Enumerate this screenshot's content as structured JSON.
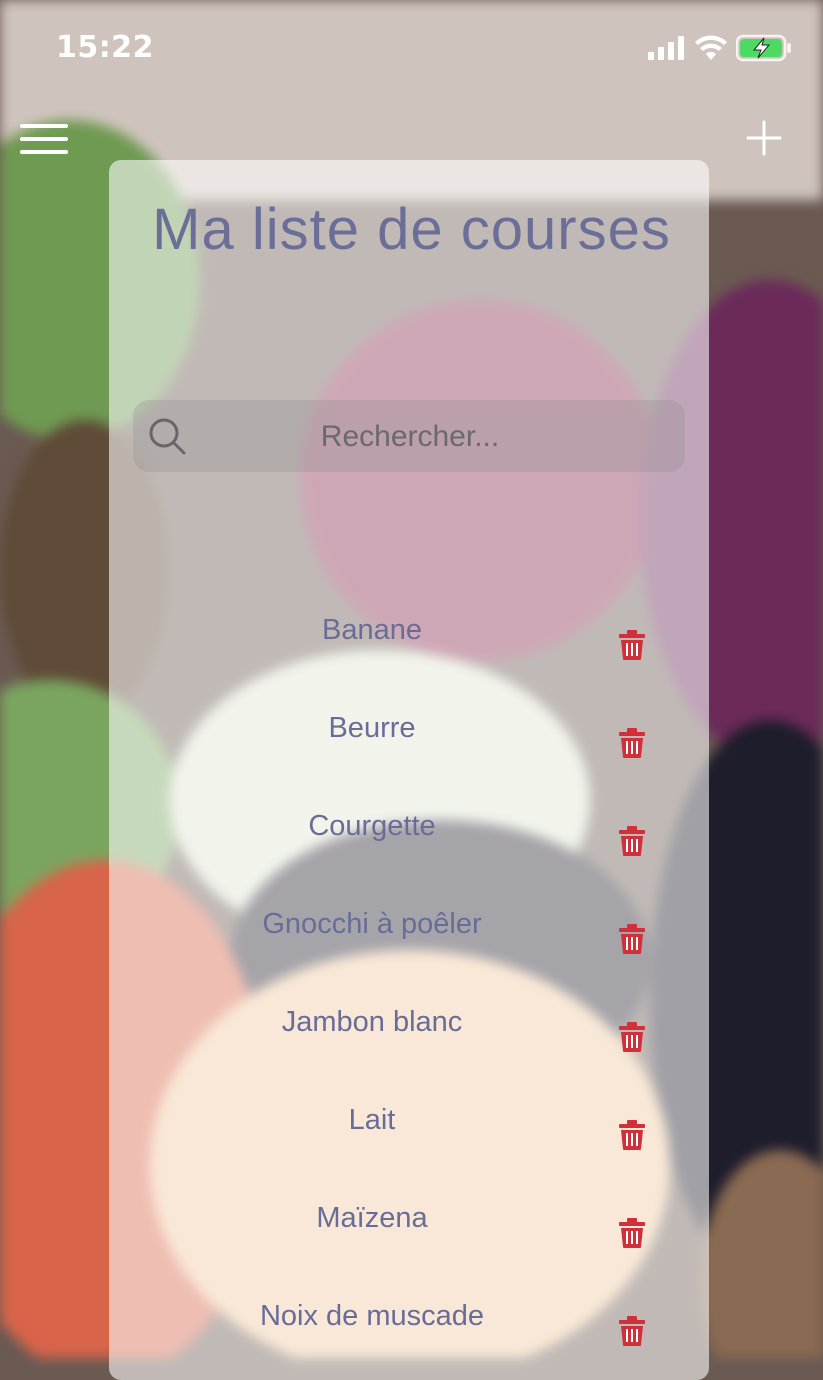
{
  "status_bar": {
    "time": "15:22",
    "icons": [
      "cellular-signal-icon",
      "wifi-icon",
      "battery-charging-icon"
    ]
  },
  "nav": {
    "menu_icon": "hamburger-menu-icon",
    "add_icon": "plus-icon"
  },
  "header": {
    "title": "Ma liste de courses"
  },
  "search": {
    "placeholder": "Rechercher...",
    "icon": "search-icon"
  },
  "colors": {
    "title": "#6b6f98",
    "item_text": "#686d98",
    "trash": "#d0303a"
  },
  "items": [
    {
      "label": "Banane"
    },
    {
      "label": "Beurre"
    },
    {
      "label": "Courgette"
    },
    {
      "label": "Gnocchi à poêler"
    },
    {
      "label": "Jambon blanc"
    },
    {
      "label": "Lait"
    },
    {
      "label": "Maïzena"
    },
    {
      "label": "Noix de muscade"
    }
  ],
  "item_action_icon": "trash-icon"
}
